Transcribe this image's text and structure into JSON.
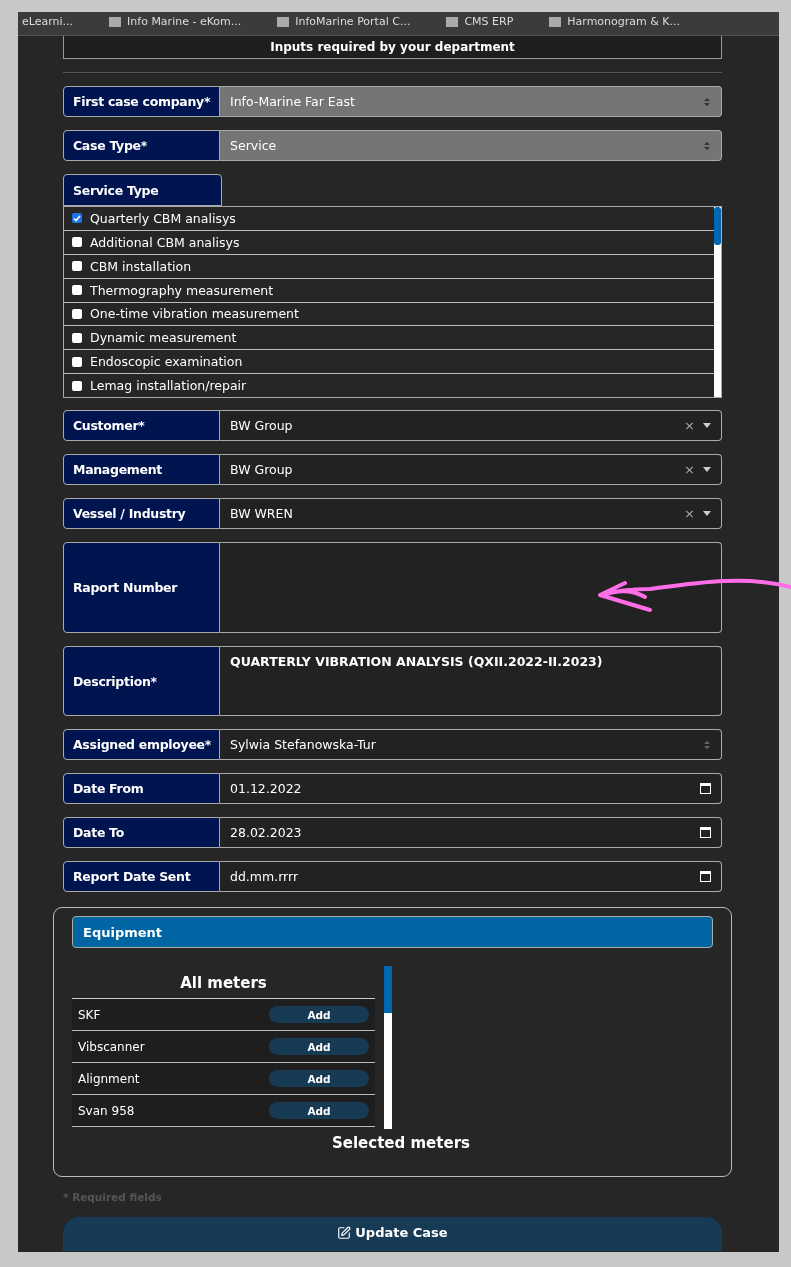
{
  "bookmarks": [
    {
      "label": "eLearni..."
    },
    {
      "label": "Info Marine - eKom..."
    },
    {
      "label": "InfoMarine Portal C..."
    },
    {
      "label": "CMS ERP"
    },
    {
      "label": "Harmonogram & K..."
    }
  ],
  "header_box": {
    "text": "Inputs required by your department"
  },
  "fields": [
    {
      "kind": "select",
      "label": "First case company*",
      "value": "Info-Marine Far East",
      "disabled": true
    },
    {
      "kind": "select",
      "label": "Case Type*",
      "value": "Service",
      "disabled": true
    }
  ],
  "service_type": {
    "label": "Service Type",
    "options": [
      {
        "label": "Quarterly CBM analisys",
        "checked": true
      },
      {
        "label": "Additional CBM analisys",
        "checked": false
      },
      {
        "label": "CBM installation",
        "checked": false
      },
      {
        "label": "Thermography measurement",
        "checked": false
      },
      {
        "label": "One-time vibration measurement",
        "checked": false
      },
      {
        "label": "Dynamic measurement",
        "checked": false
      },
      {
        "label": "Endoscopic examination",
        "checked": false
      },
      {
        "label": "Lemag installation/repair",
        "checked": false
      }
    ]
  },
  "fields2": [
    {
      "kind": "combo",
      "label": "Customer*",
      "value": "BW Group",
      "clear": "×"
    },
    {
      "kind": "combo",
      "label": "Management",
      "value": "BW Group",
      "clear": "×"
    },
    {
      "kind": "combo",
      "label": "Vessel / Industry",
      "value": "BW WREN",
      "clear": "×"
    },
    {
      "kind": "textarea",
      "label": "Raport Number"
    },
    {
      "kind": "textarea",
      "label": "Description*",
      "value": "QUARTERLY VIBRATION ANALYSIS (QXII.2022-II.2023)"
    },
    {
      "kind": "select",
      "label": "Assigned employee*",
      "value": "Sylwia Stefanowska-Tur",
      "disabled": false
    },
    {
      "kind": "date",
      "label": "Date From",
      "value": "01.12.2022"
    },
    {
      "kind": "date",
      "label": "Date To",
      "value": "28.02.2023"
    },
    {
      "kind": "date",
      "label": "Report Date Sent",
      "value": "dd.mm.rrrr"
    }
  ],
  "equipment": {
    "title": "Equipment",
    "all_title": "All meters",
    "selected_title": "Selected meters",
    "meters": [
      {
        "name": "SKF",
        "action": "Add"
      },
      {
        "name": "Vibscanner",
        "action": "Add"
      },
      {
        "name": "Alignment",
        "action": "Add"
      },
      {
        "name": "Svan 958",
        "action": "Add"
      }
    ]
  },
  "required_note": "* Required fields",
  "submit": {
    "label": "Update Case"
  }
}
